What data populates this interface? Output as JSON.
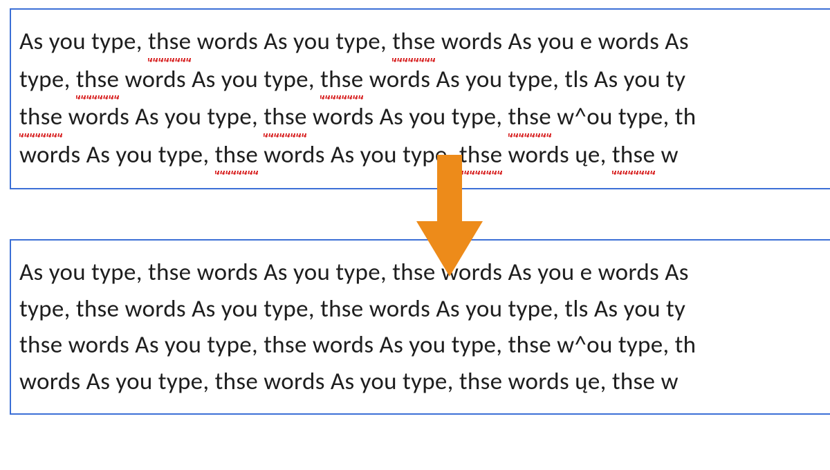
{
  "misspelled_word": "thse",
  "colors": {
    "border": "#3b6fd6",
    "squiggle": "#d82424",
    "arrow": "#ed8b1a",
    "text": "#1e1e1e"
  },
  "top_box": {
    "spellcheck_underline": true,
    "lines": [
      {
        "segments": [
          {
            "t": "As you type, "
          },
          {
            "t": "thse",
            "m": true
          },
          {
            "t": " words As you type, "
          },
          {
            "t": "thse",
            "m": true
          },
          {
            "t": " words As you e words As"
          }
        ]
      },
      {
        "segments": [
          {
            "t": "type, "
          },
          {
            "t": "thse",
            "m": true
          },
          {
            "t": " words As you type, "
          },
          {
            "t": "thse",
            "m": true
          },
          {
            "t": " words As you type, tls As you ty"
          }
        ]
      },
      {
        "segments": [
          {
            "t": "thse",
            "m": true
          },
          {
            "t": " words As you type, "
          },
          {
            "t": "thse",
            "m": true
          },
          {
            "t": " words As you type, "
          },
          {
            "t": "thse",
            "m": true
          },
          {
            "t": " w^ou type, th"
          }
        ]
      },
      {
        "segments": [
          {
            "t": "words As you type, "
          },
          {
            "t": "thse",
            "m": true
          },
          {
            "t": " words As you type, "
          },
          {
            "t": "thse",
            "m": true
          },
          {
            "t": " words ųe, "
          },
          {
            "t": "thse",
            "m": true
          },
          {
            "t": " w"
          }
        ]
      }
    ]
  },
  "bottom_box": {
    "spellcheck_underline": false,
    "lines": [
      {
        "segments": [
          {
            "t": "As you type, thse words As you type, thse words As you e words As"
          }
        ]
      },
      {
        "segments": [
          {
            "t": "type, thse words As you type, thse words As you type, tls As you ty"
          }
        ]
      },
      {
        "segments": [
          {
            "t": "thse words As you type, thse words As you type, thse w^ou type, th"
          }
        ]
      },
      {
        "segments": [
          {
            "t": "words As you type, thse words As you type, thse words ųe, thse w"
          }
        ]
      }
    ]
  },
  "arrow": {
    "direction": "down",
    "meaning": "before-to-after"
  }
}
